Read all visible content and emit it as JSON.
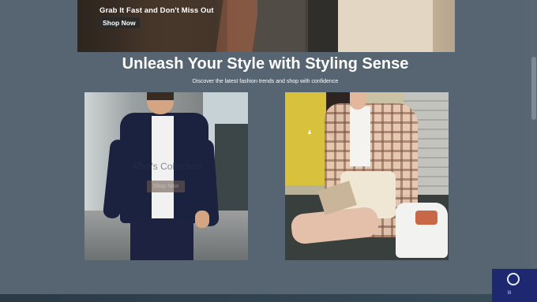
{
  "hero": {
    "tagline": "Grab It Fast and Don't Miss Out",
    "shop_now_label": "Shop Now"
  },
  "section": {
    "headline": "Unleash Your Style with Styling Sense",
    "subline": "Discover the latest fashion trends and shop with confidence"
  },
  "cards": [
    {
      "name": "mens-collection",
      "overlay_title": "Men's Collection",
      "overlay_button": "Shop Now"
    },
    {
      "name": "womens-collection"
    }
  ],
  "colors": {
    "page_background": "#566571",
    "headline_text": "#ffffff",
    "button_dark": "#2b2b2b",
    "taskbar": "#2b3a45"
  },
  "icons": {
    "corner_widget": "circle-logo-icon"
  }
}
